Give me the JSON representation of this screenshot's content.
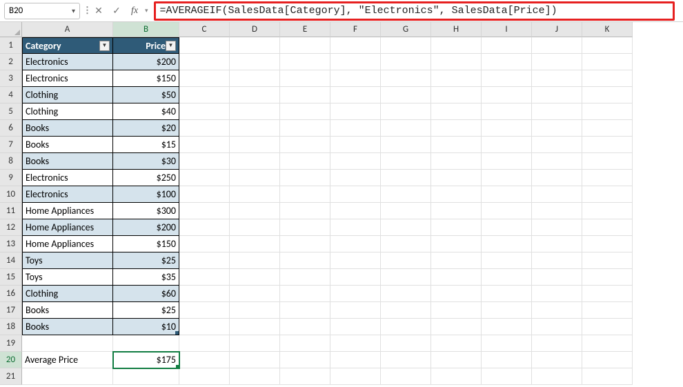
{
  "nameBox": {
    "value": "B20"
  },
  "formulaBar": {
    "formula": "=AVERAGEIF(SalesData[Category], \"Electronics\", SalesData[Price])"
  },
  "columns": [
    "A",
    "B",
    "C",
    "D",
    "E",
    "F",
    "G",
    "H",
    "I",
    "J",
    "K"
  ],
  "activeColumn": "B",
  "rowCount": 21,
  "activeRow": 20,
  "table": {
    "headers": {
      "A": "Category",
      "B": "Price"
    },
    "rows": [
      {
        "A": "Electronics",
        "B": "$200"
      },
      {
        "A": "Electronics",
        "B": "$150"
      },
      {
        "A": "Clothing",
        "B": "$50"
      },
      {
        "A": "Clothing",
        "B": "$40"
      },
      {
        "A": "Books",
        "B": "$20"
      },
      {
        "A": "Books",
        "B": "$15"
      },
      {
        "A": "Books",
        "B": "$30"
      },
      {
        "A": "Electronics",
        "B": "$250"
      },
      {
        "A": "Electronics",
        "B": "$100"
      },
      {
        "A": "Home Appliances",
        "B": "$300"
      },
      {
        "A": "Home Appliances",
        "B": "$200"
      },
      {
        "A": "Home Appliances",
        "B": "$150"
      },
      {
        "A": "Toys",
        "B": "$25"
      },
      {
        "A": "Toys",
        "B": "$35"
      },
      {
        "A": "Clothing",
        "B": "$60"
      },
      {
        "A": "Books",
        "B": "$25"
      },
      {
        "A": "Books",
        "B": "$10"
      }
    ]
  },
  "summary": {
    "label": "Average Price",
    "value": "$175"
  },
  "icons": {
    "dropdown": "▾",
    "cancel": "✕",
    "enter": "✓",
    "fx": "fx",
    "filter": "▼"
  }
}
